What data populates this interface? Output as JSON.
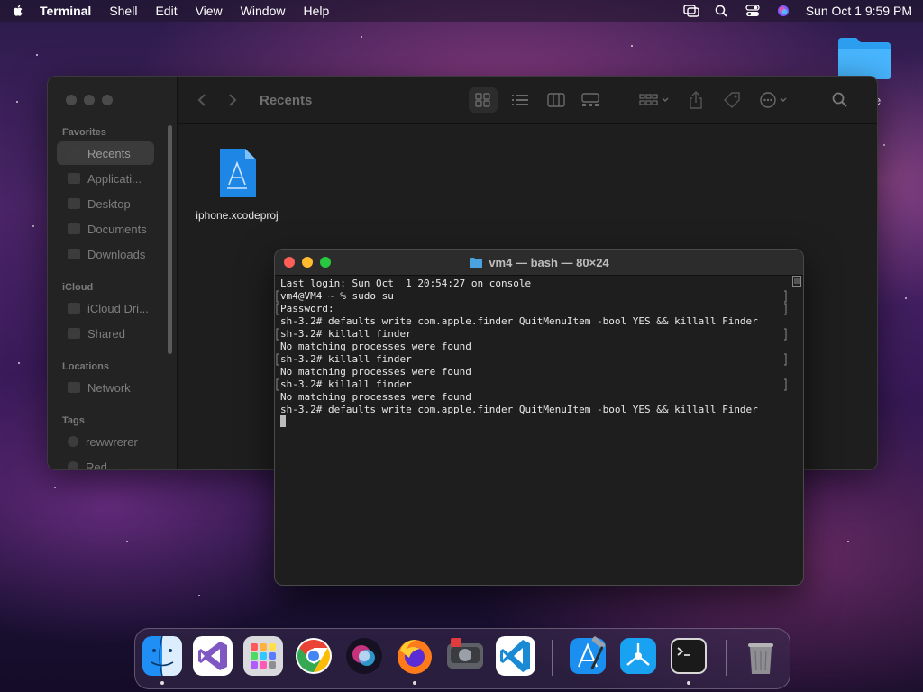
{
  "menubar": {
    "app_name": "Terminal",
    "menus": [
      "Shell",
      "Edit",
      "View",
      "Window",
      "Help"
    ],
    "clock": "Sun Oct 1  9:59 PM"
  },
  "desktop": {
    "folder_label": "e"
  },
  "finder": {
    "title": "Recents",
    "sidebar": {
      "favorites_header": "Favorites",
      "favorites": [
        "Recents",
        "Applicati...",
        "Desktop",
        "Documents",
        "Downloads"
      ],
      "icloud_header": "iCloud",
      "icloud": [
        "iCloud Dri...",
        "Shared"
      ],
      "locations_header": "Locations",
      "locations": [
        "Network"
      ],
      "tags_header": "Tags",
      "tags": [
        "rewwrerer",
        "Red"
      ]
    },
    "files": [
      {
        "name": "iphone.xcodeproj",
        "icon": "xcodeproj-icon"
      }
    ]
  },
  "terminal": {
    "title": "vm4 — bash — 80×24",
    "lines": [
      "Last login: Sun Oct  1 20:54:27 on console",
      "vm4@VM4 ~ % sudo su",
      "Password:",
      "sh-3.2# defaults write com.apple.finder QuitMenuItem -bool YES && killall Finder",
      "sh-3.2# killall finder",
      "No matching processes were found",
      "sh-3.2# killall finder",
      "No matching processes were found",
      "sh-3.2# killall finder",
      "No matching processes were found",
      "sh-3.2# defaults write com.apple.finder QuitMenuItem -bool YES && killall Finder"
    ]
  },
  "dock": {
    "apps": [
      "Finder",
      "Visual Studio",
      "Launchpad",
      "Chrome",
      "Siri",
      "Firefox",
      "Disk Utility",
      "Visual Studio Code",
      "Xcode",
      "Instruments",
      "Terminal",
      "Trash"
    ]
  }
}
